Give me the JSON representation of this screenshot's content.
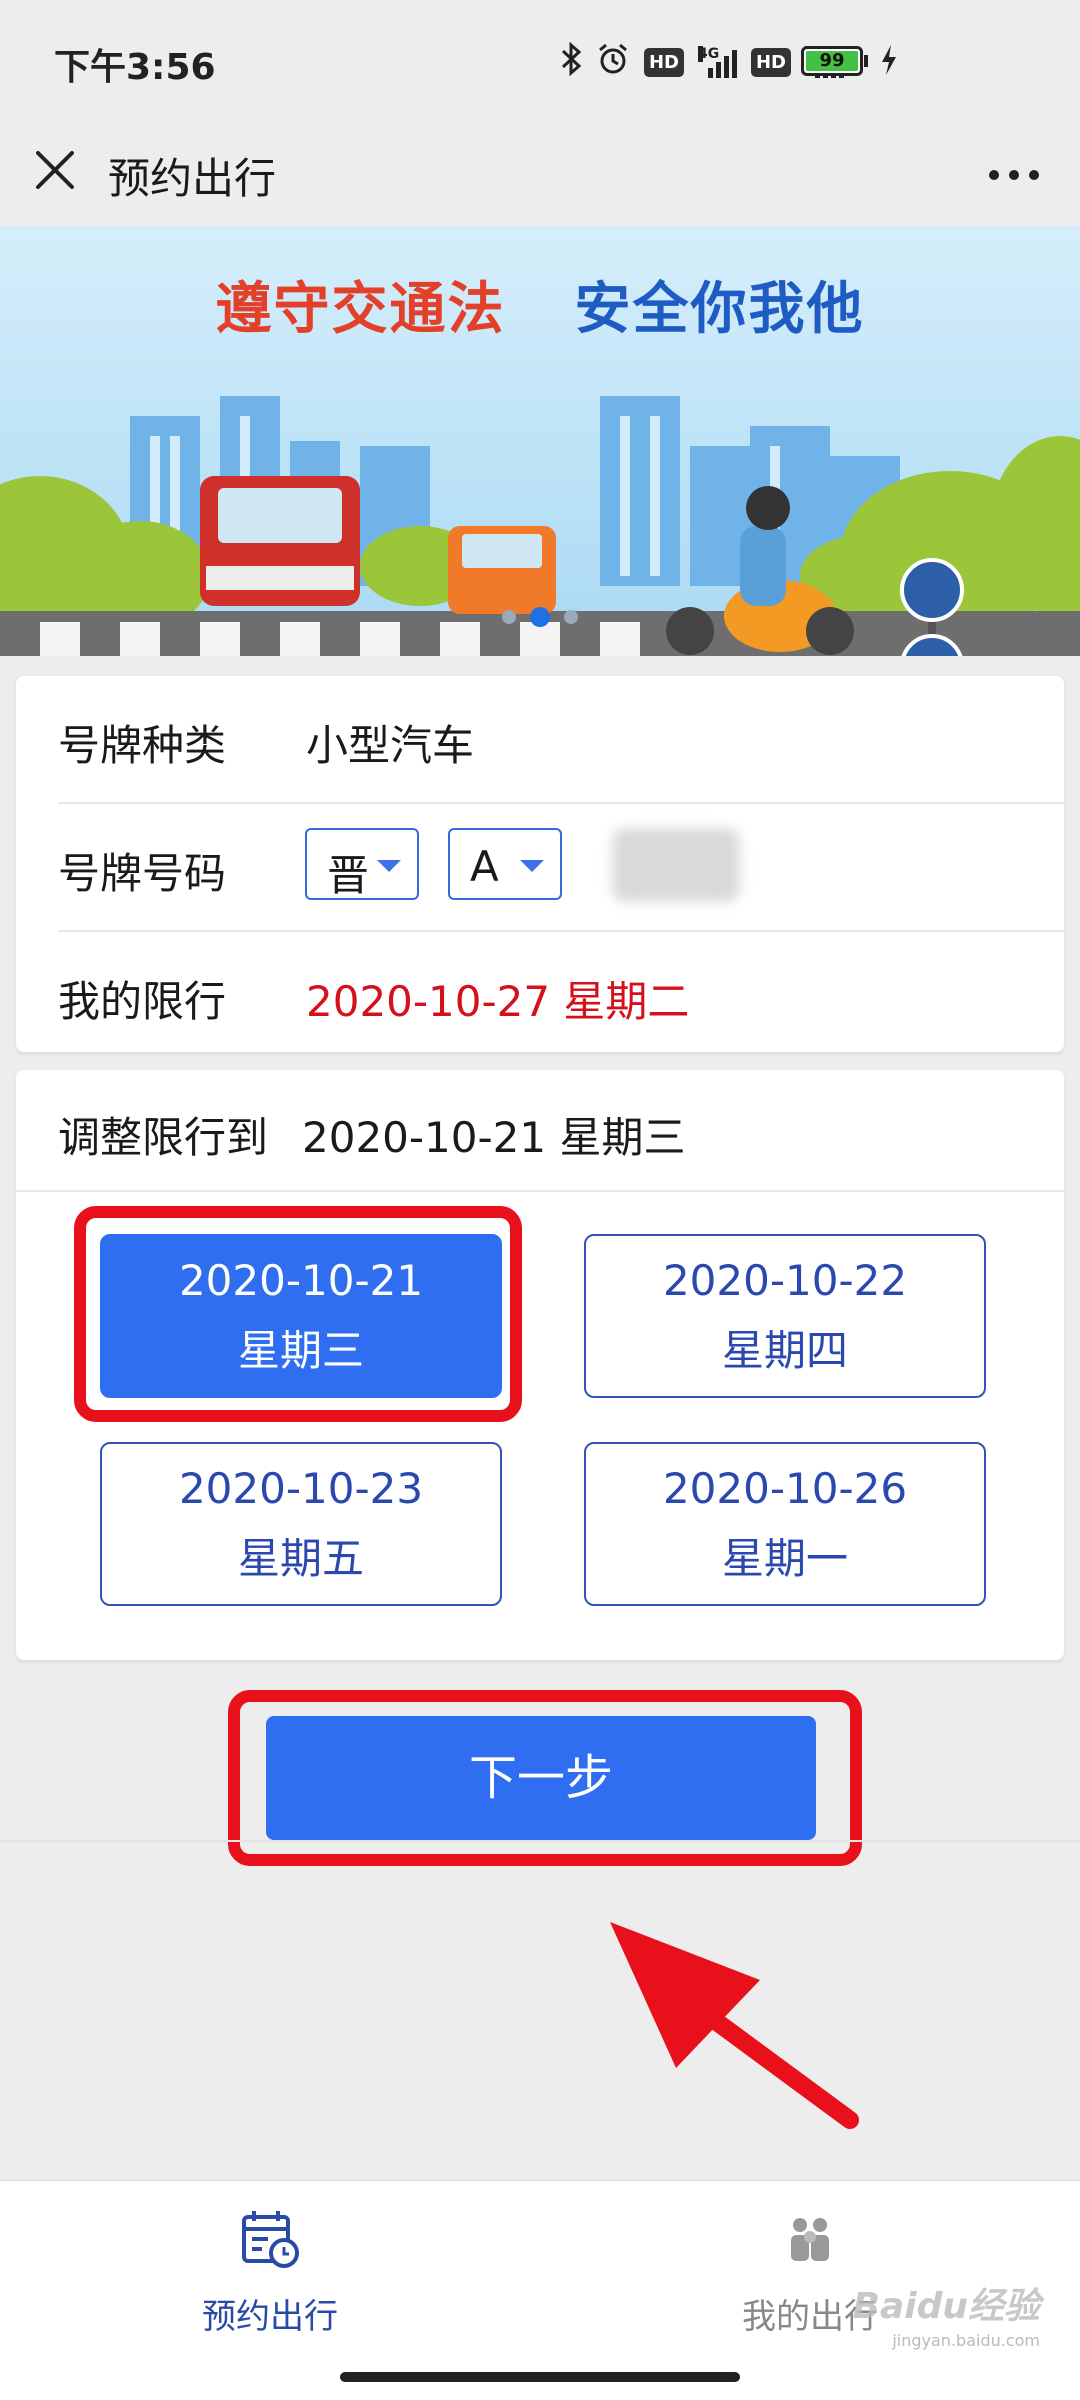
{
  "status_bar": {
    "time": "下午3:56",
    "battery": "99",
    "network_a": "4G",
    "network_b": "4G",
    "hd_a": "HD",
    "hd_b": "HD"
  },
  "header": {
    "title": "预约出行"
  },
  "banner": {
    "slogan_part1": "遵守交通法",
    "slogan_part2": "安全你我他"
  },
  "info": {
    "plate_type_label": "号牌种类",
    "plate_type_value": "小型汽车",
    "plate_number_label": "号牌号码",
    "province_select": "晋",
    "letter_select": "A",
    "my_restriction_label": "我的限行",
    "my_restriction_value": "2020-10-27 星期二"
  },
  "adjust": {
    "label": "调整限行到",
    "value": "2020-10-21 星期三",
    "options": [
      {
        "date": "2020-10-21",
        "weekday": "星期三",
        "selected": true
      },
      {
        "date": "2020-10-22",
        "weekday": "星期四",
        "selected": false
      },
      {
        "date": "2020-10-23",
        "weekday": "星期五",
        "selected": false
      },
      {
        "date": "2020-10-26",
        "weekday": "星期一",
        "selected": false
      }
    ]
  },
  "next_button": "下一步",
  "tabs": [
    {
      "label": "预约出行",
      "icon": "calendar-clock-icon",
      "active": true
    },
    {
      "label": "我的出行",
      "icon": "people-icon",
      "active": false
    }
  ],
  "watermark": {
    "text": "Baidu经验",
    "sub": "jingyan.baidu.com"
  },
  "colors": {
    "primary": "#2f6ef0",
    "border_blue": "#3252b8",
    "red": "#d4111b",
    "highlight": "#e8101a"
  }
}
